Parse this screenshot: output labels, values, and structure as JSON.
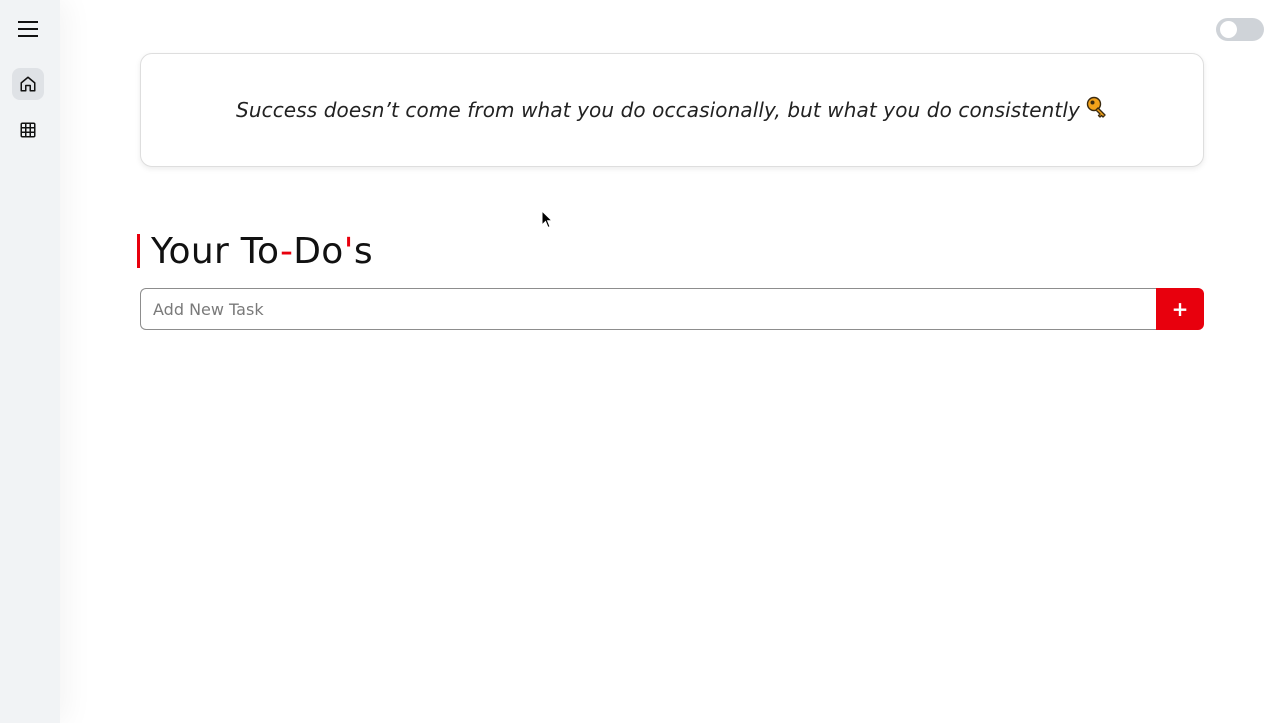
{
  "sidebar": {
    "menu_icon": "hamburger-menu-icon",
    "items": [
      {
        "icon": "home-icon",
        "active": true
      },
      {
        "icon": "grid-icon",
        "active": false
      }
    ]
  },
  "theme_toggle": {
    "state": "off"
  },
  "quote": {
    "text": "Success doesn’t come from what you do occasionally, but what you do consistently",
    "emoji": "key-icon"
  },
  "heading": {
    "part1": "Your To",
    "dash": "-",
    "part2": "Do",
    "apostrophe": "'",
    "part3": "s"
  },
  "task_input": {
    "placeholder": "Add New Task",
    "value": ""
  },
  "add_button": {
    "label": "+"
  },
  "colors": {
    "accent": "#e8000d",
    "sidebar_bg": "#f1f3f5"
  }
}
